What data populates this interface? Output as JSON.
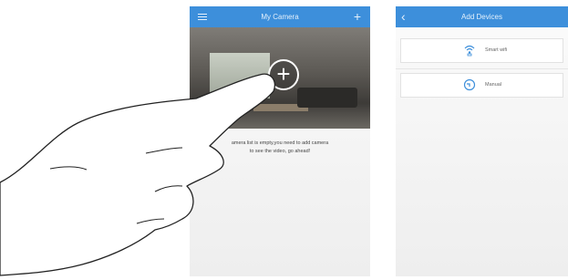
{
  "screen_left": {
    "title": "My Camera",
    "menu_icon": "hamburger-menu-icon",
    "add_icon": "plus-icon",
    "photo_overlay_icon": "add-camera-plus-icon",
    "empty_message_line1": "amera list is empty,you need to add camera",
    "empty_message_line2": "to see the video,  go ahead!"
  },
  "screen_right": {
    "title": "Add Devices",
    "back_icon": "back-chevron-icon",
    "options": [
      {
        "label": "Smart wifi",
        "icon": "wifi-icon"
      },
      {
        "label": "Manual",
        "icon": "manual-setup-icon"
      }
    ]
  },
  "colors": {
    "title_bar": "#3d8fdb",
    "screen_bg": "#f3f3f3",
    "icon_blue": "#3d8fdb"
  }
}
